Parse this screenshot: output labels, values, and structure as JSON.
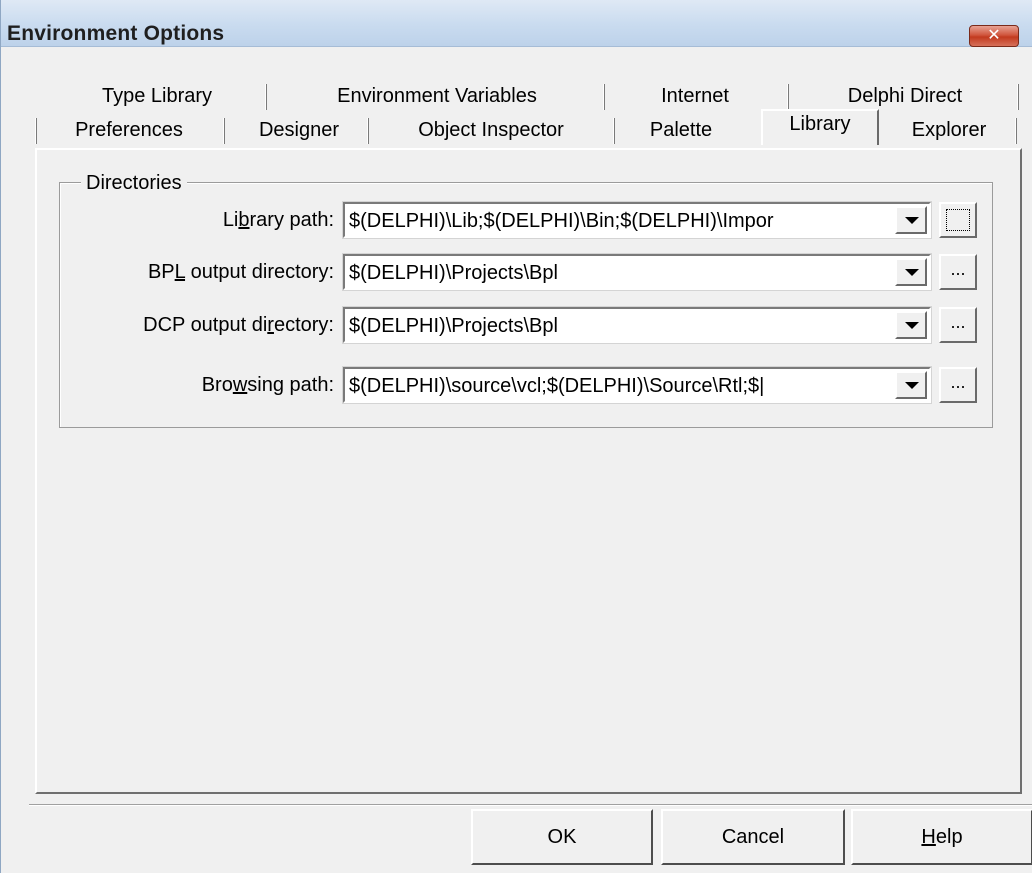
{
  "window": {
    "title": "Environment Options",
    "close_symbol": "✕"
  },
  "tabs": {
    "row_back": [
      {
        "label": "Type Library"
      },
      {
        "label": "Environment Variables"
      },
      {
        "label": "Internet"
      },
      {
        "label": "Delphi Direct"
      }
    ],
    "row_front": [
      {
        "label": "Preferences"
      },
      {
        "label": "Designer"
      },
      {
        "label": "Object Inspector"
      },
      {
        "label": "Palette"
      },
      {
        "label": "Library"
      },
      {
        "label": "Explorer"
      }
    ],
    "active": "Library"
  },
  "directories": {
    "group_label": "Directories",
    "fields": [
      {
        "label_pre": "Li",
        "label_key": "b",
        "label_post": "rary path:",
        "value": "$(DELPHI)\\Lib;$(DELPHI)\\Bin;$(DELPHI)\\Impor",
        "browse_label": ""
      },
      {
        "label_pre": "BP",
        "label_key": "L",
        "label_post": " output directory:",
        "value": "$(DELPHI)\\Projects\\Bpl",
        "browse_label": "..."
      },
      {
        "label_pre": "DCP output di",
        "label_key": "r",
        "label_post": "ectory:",
        "value": "$(DELPHI)\\Projects\\Bpl",
        "browse_label": "..."
      },
      {
        "label_pre": "Bro",
        "label_key": "w",
        "label_post": "sing path:",
        "value": "$(DELPHI)\\source\\vcl;$(DELPHI)\\Source\\Rtl;$|",
        "browse_label": "..."
      }
    ]
  },
  "buttons": {
    "ok": "OK",
    "cancel": "Cancel",
    "help_key": "H",
    "help_rest": "elp"
  }
}
